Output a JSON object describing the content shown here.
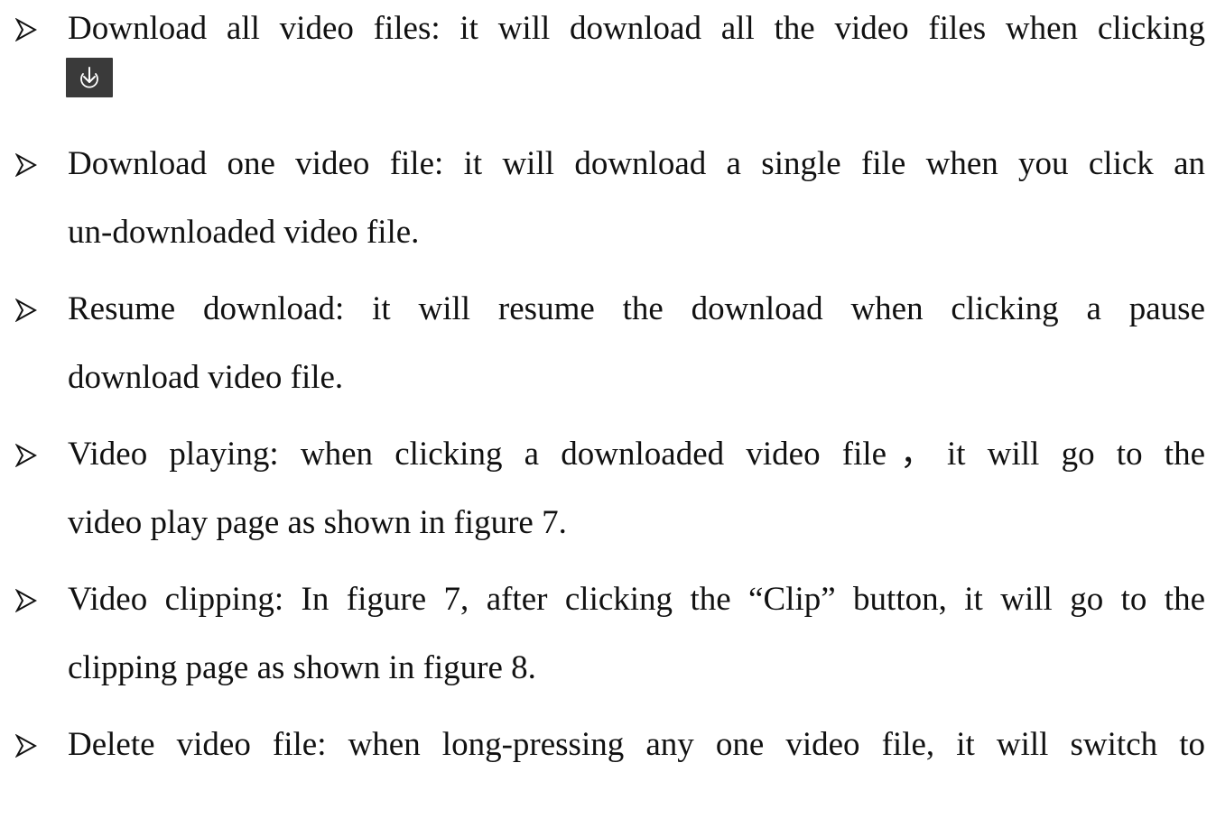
{
  "bullets": [
    {
      "line1": "Download all video files: it will download all the video files when clicking",
      "icon": "download-icon"
    },
    {
      "line1": "Download one video file: it will download a single file when you click an",
      "line2": "un-downloaded video file."
    },
    {
      "line1": "Resume download: it will resume the download when clicking a pause",
      "line2": "download video file."
    },
    {
      "line1": "Video playing: when clicking a downloaded video file，it will go to the",
      "line2": "video play page as shown in figure 7."
    },
    {
      "line1": "Video clipping: In figure 7, after clicking the “Clip” button, it will go to the",
      "line2": "clipping page as shown in figure 8."
    },
    {
      "line1": "Delete video file: when long-pressing any one video file, it will switch to"
    }
  ],
  "colors": {
    "text": "#111111",
    "icon_bg": "#3a3a3a",
    "icon_fg": "#ffffff"
  },
  "bullet_glyph": "arrow-bullet-icon"
}
